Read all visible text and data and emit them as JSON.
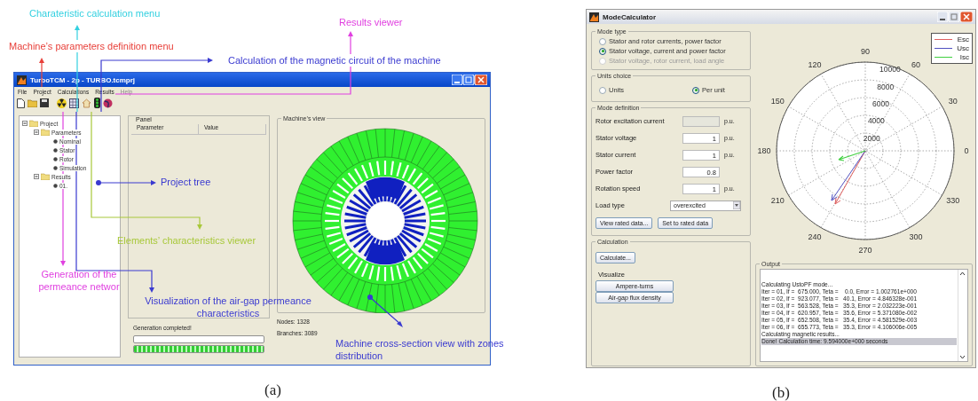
{
  "figure_a": {
    "annotations": [
      {
        "text": "Charateristic calculation menu",
        "color": "#33d0e0"
      },
      {
        "text": "Results viewer",
        "color": "#e040e0"
      },
      {
        "text": "Machine’s parameters definition menu",
        "color": "#e8403a"
      },
      {
        "text": "Calculation of the magnetic circuit of the machine",
        "color": "#3a3ad0"
      },
      {
        "text": "Project tree",
        "color": "#3a3ad0"
      },
      {
        "text": "Elements’ characteristics viewer",
        "color": "#a8c83a"
      },
      {
        "text": "Generation of the permeance networ",
        "color": "#e040e0"
      },
      {
        "text": "Visualization of the air-gap permeance characteristics",
        "color": "#3a3ad0"
      },
      {
        "text": "Machine cross-section view with zones distribution",
        "color": "#3a3ad0"
      }
    ],
    "window": {
      "title": "TurboTCM - 2p - TURBO.tcmprj",
      "menu": [
        {
          "label": "File",
          "disabled": false
        },
        {
          "label": "Project",
          "disabled": false
        },
        {
          "label": "Calculations",
          "disabled": false
        },
        {
          "label": "Results",
          "disabled": false
        },
        {
          "label": "Help",
          "disabled": true
        }
      ],
      "tree": [
        {
          "label": "Project",
          "expanded": true,
          "children": [
            {
              "label": "Parameters",
              "expanded": true,
              "children": [
                {
                  "label": "Nominal"
                },
                {
                  "label": "Stator"
                },
                {
                  "label": "Rotor"
                },
                {
                  "label": "Simulation"
                }
              ]
            },
            {
              "label": "Results",
              "expanded": true,
              "children": [
                {
                  "label": "01."
                }
              ]
            }
          ]
        }
      ],
      "panel_tag": "Panel",
      "table": {
        "columns": [
          "Parameter",
          "Value"
        ]
      },
      "machine_view": {
        "title": "Machine’s view"
      },
      "status": "Generation completed!",
      "progress": [
        {
          "level": 0
        },
        {
          "level": 1
        }
      ],
      "nodes": "Nodes: 1328",
      "branches": "Branches: 3089"
    },
    "caption": "(a)"
  },
  "figure_b": {
    "window": {
      "title": "ModeCalculator",
      "mode_type": {
        "title": "Mode type",
        "options": [
          {
            "label": "Stator and rotor currents, power factor",
            "selected": false,
            "disabled": false
          },
          {
            "label": "Stator voltage, current and power factor",
            "selected": true,
            "disabled": false
          },
          {
            "label": "Stator voltage, rotor current, load angle",
            "selected": false,
            "disabled": true
          }
        ]
      },
      "units_choice": {
        "title": "Units choice",
        "options": [
          {
            "label": "Units",
            "selected": false
          },
          {
            "label": "Per unit",
            "selected": true
          }
        ]
      },
      "mode_definition": {
        "title": "Mode definition",
        "rows": [
          {
            "kind": "field",
            "label": "Rotor excitation current",
            "unit": "p.u.",
            "disabled": true
          },
          {
            "kind": "field",
            "label": "Stator voltage",
            "value": "1",
            "unit": "p.u.",
            "disabled": false
          },
          {
            "kind": "field",
            "label": "Stator current",
            "value": "1",
            "unit": "p.u.",
            "disabled": false
          },
          {
            "kind": "field",
            "label": "Power factor",
            "value": "0.8",
            "disabled": false
          },
          {
            "kind": "field",
            "label": "Rotation speed",
            "value": "1",
            "unit": "p.u.",
            "disabled": false
          },
          {
            "kind": "select",
            "label": "Load type",
            "value": "overexcited"
          }
        ],
        "buttons": [
          "View rated data...",
          "Set to rated data"
        ]
      },
      "calculation": {
        "title": "Calculation",
        "button": "Calculate...",
        "visualize_label": "Visualize",
        "buttons": [
          "Ampere-turns",
          "Air-gap flux density"
        ]
      },
      "polar": {
        "angle_labels": [
          "0",
          "30",
          "60",
          "90",
          "120",
          "150",
          "180",
          "210",
          "240",
          "270",
          "300",
          "330"
        ],
        "radius_labels": [
          "2000",
          "4000",
          "6000",
          "8000",
          "10000"
        ],
        "legend": [
          {
            "label": "Esc",
            "color": "#e06060"
          },
          {
            "label": "Usc",
            "color": "#5050c0"
          },
          {
            "label": "Isc",
            "color": "#40d040"
          }
        ]
      },
      "output": {
        "title": "Output",
        "lines": [
          {
            "text": "Calculating UstoPF mode...",
            "selected": false
          },
          {
            "text": "Iter = 01, If =  675.000, Teta =    0.0, Error = 1.002761e+000",
            "selected": false
          },
          {
            "text": "Iter = 02, If =  923.077, Teta =   40.1, Error = 4.846328e-001",
            "selected": false
          },
          {
            "text": "Iter = 03, If =  563.528, Teta =   35.3, Error = 2.032223e-001",
            "selected": false
          },
          {
            "text": "Iter = 04, If =  620.957, Teta =   35.6, Error = 5.371080e-002",
            "selected": false
          },
          {
            "text": "Iter = 05, If =  652.508, Teta =   35.4, Error = 4.581529e-003",
            "selected": false
          },
          {
            "text": "Iter = 06, If =  655.773, Teta =   35.3, Error = 4.106006e-005",
            "selected": false
          },
          {
            "text": "Calculating magnetic results...",
            "selected": false
          },
          {
            "text": "Done! Calculation time: 9.594000e+000 seconds",
            "selected": true
          }
        ]
      }
    },
    "caption": "(b)"
  }
}
